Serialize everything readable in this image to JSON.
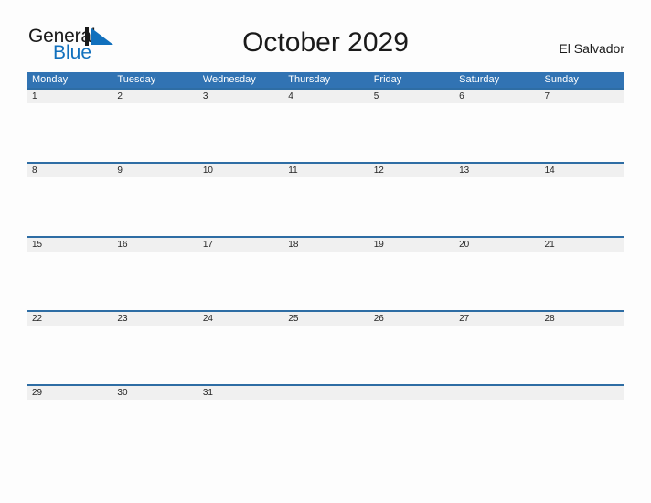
{
  "brand": {
    "name_part1": "General",
    "name_part2": "Blue",
    "triangle_icon": "blue-triangle-icon",
    "color_dark": "#1a1a1a",
    "color_blue": "#1170bd"
  },
  "header": {
    "title": "October 2029",
    "country": "El Salvador"
  },
  "calendar": {
    "header_color": "#3173b3",
    "date_band_color": "#f0f0f0",
    "row_rule_color": "#2e6da4",
    "weekdays": [
      "Monday",
      "Tuesday",
      "Wednesday",
      "Thursday",
      "Friday",
      "Saturday",
      "Sunday"
    ],
    "weeks": [
      {
        "days": [
          "1",
          "2",
          "3",
          "4",
          "5",
          "6",
          "7"
        ]
      },
      {
        "days": [
          "8",
          "9",
          "10",
          "11",
          "12",
          "13",
          "14"
        ]
      },
      {
        "days": [
          "15",
          "16",
          "17",
          "18",
          "19",
          "20",
          "21"
        ]
      },
      {
        "days": [
          "22",
          "23",
          "24",
          "25",
          "26",
          "27",
          "28"
        ]
      },
      {
        "days": [
          "29",
          "30",
          "31",
          "",
          "",
          "",
          ""
        ]
      }
    ]
  }
}
